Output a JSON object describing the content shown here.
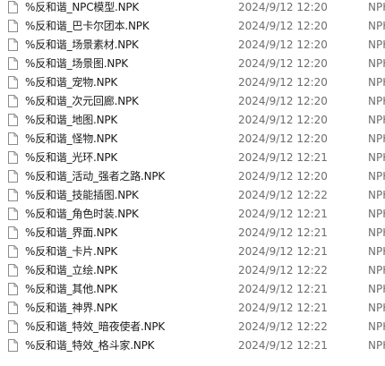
{
  "icon": "blank-file-icon",
  "files": [
    {
      "name": "%反和谐_NPC模型.NPK",
      "date": "2024/9/12 12:20",
      "type": "NPK"
    },
    {
      "name": "%反和谐_巴卡尔团本.NPK",
      "date": "2024/9/12 12:20",
      "type": "NPK"
    },
    {
      "name": "%反和谐_场景素材.NPK",
      "date": "2024/9/12 12:20",
      "type": "NPK"
    },
    {
      "name": "%反和谐_场景图.NPK",
      "date": "2024/9/12 12:20",
      "type": "NPK"
    },
    {
      "name": "%反和谐_宠物.NPK",
      "date": "2024/9/12 12:20",
      "type": "NPK"
    },
    {
      "name": "%反和谐_次元回廊.NPK",
      "date": "2024/9/12 12:20",
      "type": "NPK"
    },
    {
      "name": "%反和谐_地图.NPK",
      "date": "2024/9/12 12:20",
      "type": "NPK"
    },
    {
      "name": "%反和谐_怪物.NPK",
      "date": "2024/9/12 12:20",
      "type": "NPK"
    },
    {
      "name": "%反和谐_光环.NPK",
      "date": "2024/9/12 12:21",
      "type": "NPK"
    },
    {
      "name": "%反和谐_活动_强者之路.NPK",
      "date": "2024/9/12 12:20",
      "type": "NPK"
    },
    {
      "name": "%反和谐_技能插图.NPK",
      "date": "2024/9/12 12:22",
      "type": "NPK"
    },
    {
      "name": "%反和谐_角色时装.NPK",
      "date": "2024/9/12 12:21",
      "type": "NPK"
    },
    {
      "name": "%反和谐_界面.NPK",
      "date": "2024/9/12 12:21",
      "type": "NPK"
    },
    {
      "name": "%反和谐_卡片.NPK",
      "date": "2024/9/12 12:21",
      "type": "NPK"
    },
    {
      "name": "%反和谐_立绘.NPK",
      "date": "2024/9/12 12:22",
      "type": "NPK"
    },
    {
      "name": "%反和谐_其他.NPK",
      "date": "2024/9/12 12:21",
      "type": "NPK"
    },
    {
      "name": "%反和谐_神界.NPK",
      "date": "2024/9/12 12:21",
      "type": "NPK"
    },
    {
      "name": "%反和谐_特效_暗夜使者.NPK",
      "date": "2024/9/12 12:22",
      "type": "NPK"
    },
    {
      "name": "%反和谐_特效_格斗家.NPK",
      "date": "2024/9/12 12:21",
      "type": "NPK"
    }
  ]
}
